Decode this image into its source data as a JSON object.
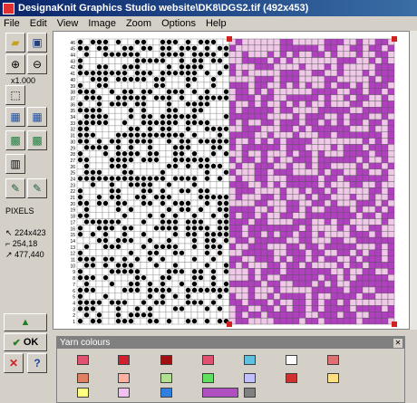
{
  "window": {
    "title": "DesignaKnit Graphics Studio  website\\DK8\\DGS2.tif (492x453)"
  },
  "menu": [
    "File",
    "Edit",
    "View",
    "Image",
    "Zoom",
    "Options",
    "Help"
  ],
  "toolbar": {
    "zoom_label": "x1.000",
    "pixels_label": "PIXELS",
    "size_value": "224x423",
    "pos_value": "254,18",
    "pos2_value": "477,440",
    "ok_label": "OK",
    "help_label": "?"
  },
  "chart": {
    "row_numbers": [
      "46",
      "45",
      "44",
      "43",
      "42",
      "41",
      "40",
      "39",
      "38",
      "37",
      "36",
      "35",
      "34",
      "33",
      "32",
      "31",
      "30",
      "29",
      "28",
      "27",
      "26",
      "25",
      "24",
      "23",
      "22",
      "21",
      "20",
      "19",
      "18",
      "17",
      "16",
      "15",
      "14",
      "13",
      "12",
      "11",
      "10",
      "9",
      "8",
      "7",
      "6",
      "5",
      "4",
      "3",
      "2",
      "1"
    ],
    "fill_color": "#000000",
    "pink_light": "#f0c8e8",
    "purple": "#b040c0",
    "marker_color": "#d02020"
  },
  "yarn": {
    "title": "Yarn colours",
    "swatches": [
      "#e05070",
      "#d02030",
      "#a01010",
      "#e05070",
      "#60c0e0",
      "#ffffff",
      "#e07070",
      "#e08060",
      "#ffb0a0",
      "#b0e090",
      "#60e060",
      "#c0c0ff",
      "#d03030",
      "#ffe080",
      "#ffff80",
      "#f0c0f0",
      "#3080e0",
      "#b050c0",
      "#808080"
    ]
  }
}
